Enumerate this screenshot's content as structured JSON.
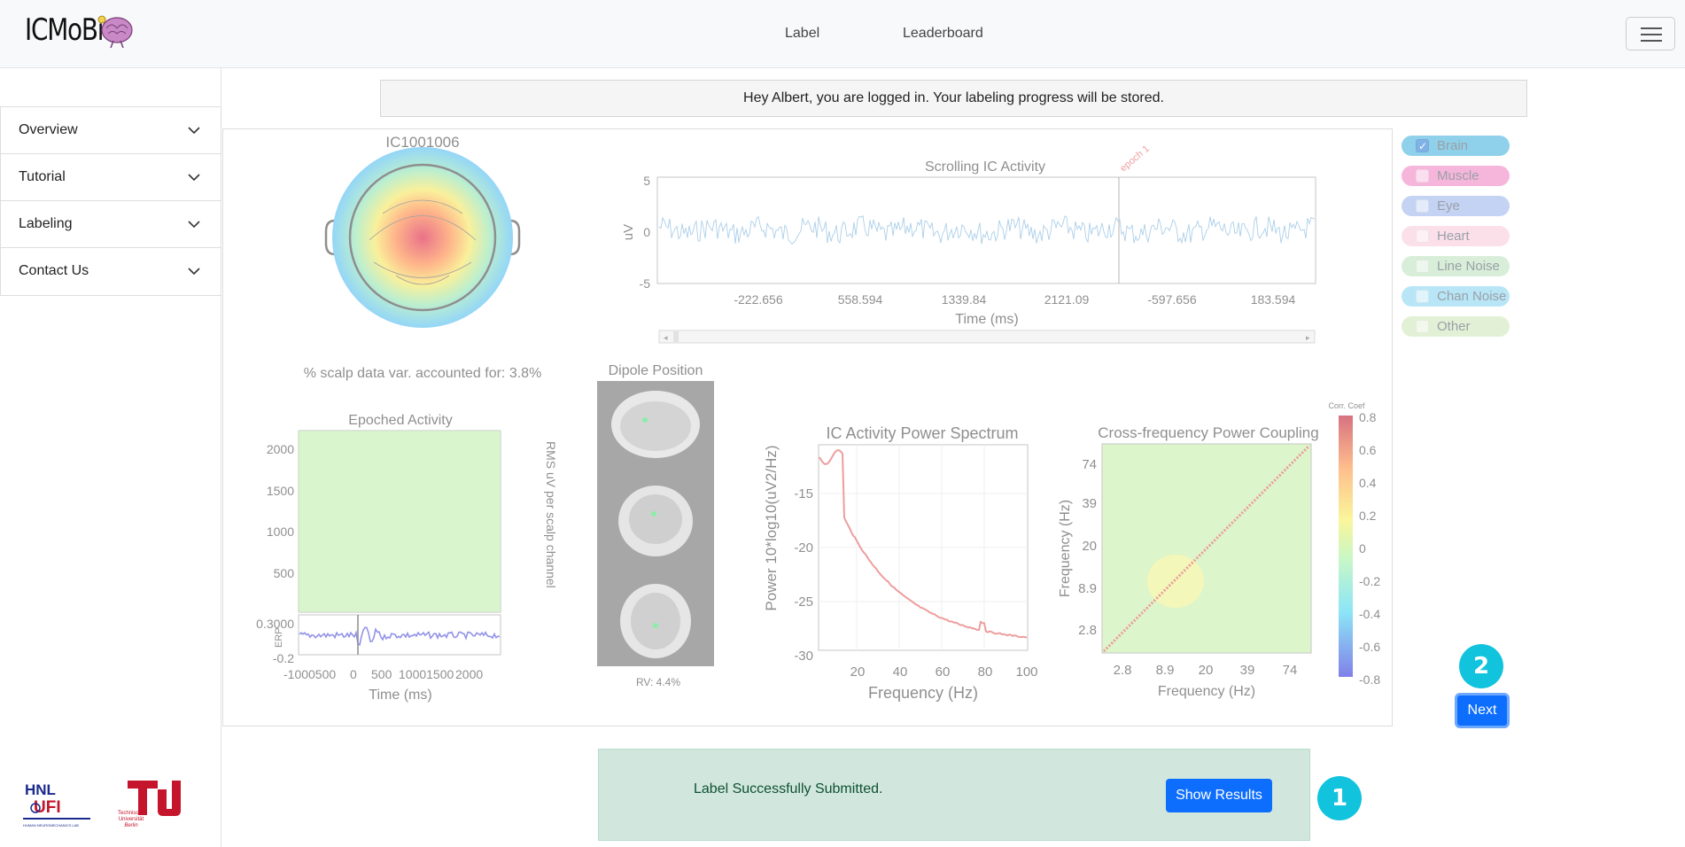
{
  "nav": {
    "logo_text": "ICMoBi",
    "links": [
      "Label",
      "Leaderboard"
    ]
  },
  "sidebar": {
    "items": [
      {
        "label": "Overview"
      },
      {
        "label": "Tutorial"
      },
      {
        "label": "Labeling"
      },
      {
        "label": "Contact Us"
      }
    ],
    "logos": [
      "HNL",
      "Technische Universität Berlin"
    ]
  },
  "alert": {
    "text": "Hey Albert, you are logged in. Your labeling progress will be stored."
  },
  "figure": {
    "ic_title": "IC1001006",
    "scalp_caption": "% scalp data var. accounted for: 3.8%",
    "scrolling_title": "Scrolling IC Activity",
    "scrolling_ylabel": "uV",
    "scrolling_yticks": [
      "5",
      "0",
      "-5"
    ],
    "scrolling_xticks": [
      "-222.656",
      "558.594",
      "1339.84",
      "2121.09",
      "-597.656",
      "183.594"
    ],
    "scrolling_xlabel": "Time (ms)",
    "epoch_marker": "epoch 1",
    "dipole_title": "Dipole Position",
    "dipole_rv": "RV: 4.4%",
    "epoched_title": "Epoched Activity",
    "epoched_yticks": [
      "2000",
      "1500",
      "1000",
      "500"
    ],
    "erp_yticks": [
      "0.3000",
      "-0.2"
    ],
    "erp_ylabel": "ERP",
    "epoched_xticks": [
      "-1000500",
      "0",
      "500",
      "10001500",
      "2000"
    ],
    "epoched_xlabel": "Time (ms)",
    "rms_label": "RMS uV per scalp channel",
    "psd_title": "IC Activity Power Spectrum",
    "psd_ylabel": "Power 10*log10(uV2/Hz)",
    "psd_yticks": [
      "-15",
      "-20",
      "-25",
      "-30"
    ],
    "psd_xticks": [
      "20",
      "40",
      "60",
      "80",
      "100"
    ],
    "psd_xlabel": "Frequency (Hz)",
    "cfc_title": "Cross-frequency Power Coupling",
    "cfc_yticks": [
      "74",
      "39",
      "20",
      "8.9",
      "2.8"
    ],
    "cfc_xticks": [
      "2.8",
      "8.9",
      "20",
      "39",
      "74"
    ],
    "cfc_xlabel": "Frequency (Hz)",
    "cfc_ylabel": "Frequency (Hz)",
    "colorbar_title": "Corr. Coef",
    "colorbar_ticks": [
      "0.8",
      "0.6",
      "0.4",
      "0.2",
      "0",
      "-0.2",
      "-0.4",
      "-0.6",
      "-0.8"
    ]
  },
  "labels": [
    {
      "name": "Brain",
      "color": "#8fd0ea",
      "checked": true
    },
    {
      "name": "Muscle",
      "color": "#f6b6dc",
      "checked": false
    },
    {
      "name": "Eye",
      "color": "#c4d3f3",
      "checked": false
    },
    {
      "name": "Heart",
      "color": "#fbe0ea",
      "checked": false
    },
    {
      "name": "Line Noise",
      "color": "#d8eed9",
      "checked": false
    },
    {
      "name": "Chan Noise",
      "color": "#b8e6f7",
      "checked": false
    },
    {
      "name": "Other",
      "color": "#e2f1d6",
      "checked": false
    }
  ],
  "badges": {
    "one": "1",
    "two": "2"
  },
  "buttons": {
    "next": "Next",
    "show_results": "Show Results"
  },
  "success": {
    "text": "Label Successfully Submitted."
  }
}
